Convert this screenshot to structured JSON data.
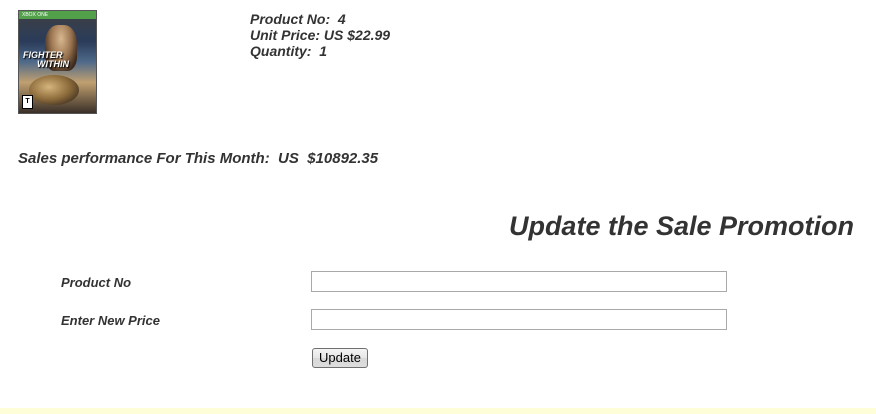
{
  "product": {
    "cover_alt": "Fighter Within game cover",
    "cover_badge": "XBOX ONE",
    "cover_title_line1": "FIGHTER",
    "cover_title_line2": "WITHIN",
    "cover_rating": "T",
    "product_no_text": "Product No:  4",
    "unit_price_text": "Unit Price: US $22.99",
    "quantity_text": "Quantity:  1"
  },
  "sales": {
    "text": "Sales performance For This Month:  US  $10892.35"
  },
  "promotion": {
    "heading": "Update the Sale Promotion",
    "product_no_label": "Product No",
    "product_no_value": "",
    "new_price_label": "Enter New Price",
    "new_price_value": "",
    "update_button": "Update"
  },
  "colors": {
    "text": "#333333",
    "footer_strip": "#fefed8"
  }
}
